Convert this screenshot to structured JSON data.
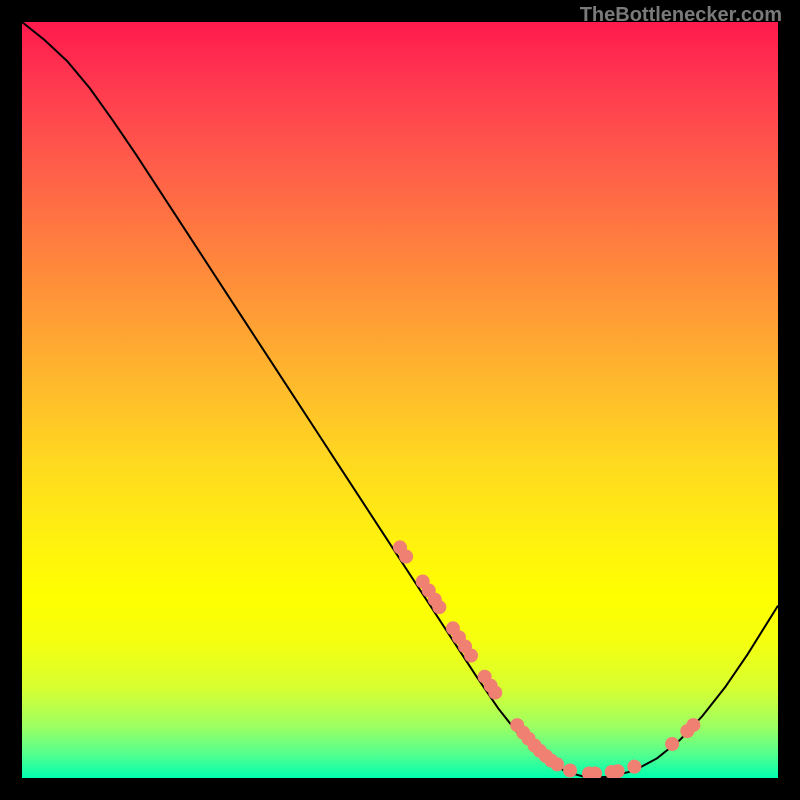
{
  "attribution": "TheBottlenecker.com",
  "chart_data": {
    "type": "line",
    "title": "",
    "xlabel": "",
    "ylabel": "",
    "xlim": [
      0,
      100
    ],
    "ylim": [
      0,
      100
    ],
    "curve": [
      {
        "x": 0.0,
        "y": 100.0
      },
      {
        "x": 3.0,
        "y": 97.6
      },
      {
        "x": 6.0,
        "y": 94.8
      },
      {
        "x": 9.0,
        "y": 91.2
      },
      {
        "x": 12.0,
        "y": 87.0
      },
      {
        "x": 15.0,
        "y": 82.6
      },
      {
        "x": 18.0,
        "y": 78.0
      },
      {
        "x": 21.0,
        "y": 73.4
      },
      {
        "x": 24.0,
        "y": 68.8
      },
      {
        "x": 27.0,
        "y": 64.2
      },
      {
        "x": 30.0,
        "y": 59.6
      },
      {
        "x": 33.0,
        "y": 55.0
      },
      {
        "x": 36.0,
        "y": 50.4
      },
      {
        "x": 39.0,
        "y": 45.8
      },
      {
        "x": 42.0,
        "y": 41.2
      },
      {
        "x": 45.0,
        "y": 36.6
      },
      {
        "x": 48.0,
        "y": 32.0
      },
      {
        "x": 51.0,
        "y": 27.4
      },
      {
        "x": 54.0,
        "y": 22.8
      },
      {
        "x": 57.0,
        "y": 18.2
      },
      {
        "x": 60.0,
        "y": 13.6
      },
      {
        "x": 63.0,
        "y": 9.2
      },
      {
        "x": 66.0,
        "y": 5.4
      },
      {
        "x": 69.0,
        "y": 2.6
      },
      {
        "x": 72.0,
        "y": 0.8
      },
      {
        "x": 75.0,
        "y": 0.0
      },
      {
        "x": 78.0,
        "y": 0.2
      },
      {
        "x": 81.0,
        "y": 1.0
      },
      {
        "x": 84.0,
        "y": 2.6
      },
      {
        "x": 87.0,
        "y": 5.0
      },
      {
        "x": 90.0,
        "y": 8.2
      },
      {
        "x": 93.0,
        "y": 12.0
      },
      {
        "x": 96.0,
        "y": 16.4
      },
      {
        "x": 100.0,
        "y": 22.8
      }
    ],
    "dots": [
      {
        "x": 50.0,
        "y": 30.5
      },
      {
        "x": 50.8,
        "y": 29.3
      },
      {
        "x": 53.0,
        "y": 26.0
      },
      {
        "x": 53.8,
        "y": 24.8
      },
      {
        "x": 54.6,
        "y": 23.6
      },
      {
        "x": 55.2,
        "y": 22.6
      },
      {
        "x": 57.0,
        "y": 19.8
      },
      {
        "x": 57.8,
        "y": 18.6
      },
      {
        "x": 58.6,
        "y": 17.4
      },
      {
        "x": 59.4,
        "y": 16.2
      },
      {
        "x": 61.2,
        "y": 13.4
      },
      {
        "x": 62.0,
        "y": 12.2
      },
      {
        "x": 62.6,
        "y": 11.3
      },
      {
        "x": 65.5,
        "y": 7.0
      },
      {
        "x": 66.3,
        "y": 6.0
      },
      {
        "x": 67.0,
        "y": 5.2
      },
      {
        "x": 67.8,
        "y": 4.3
      },
      {
        "x": 68.5,
        "y": 3.6
      },
      {
        "x": 69.3,
        "y": 2.9
      },
      {
        "x": 70.0,
        "y": 2.3
      },
      {
        "x": 70.8,
        "y": 1.8
      },
      {
        "x": 72.5,
        "y": 1.0
      },
      {
        "x": 75.0,
        "y": 0.6
      },
      {
        "x": 75.8,
        "y": 0.6
      },
      {
        "x": 78.0,
        "y": 0.8
      },
      {
        "x": 78.8,
        "y": 0.9
      },
      {
        "x": 81.0,
        "y": 1.5
      },
      {
        "x": 86.0,
        "y": 4.5
      },
      {
        "x": 88.0,
        "y": 6.2
      },
      {
        "x": 88.8,
        "y": 7.0
      }
    ]
  }
}
